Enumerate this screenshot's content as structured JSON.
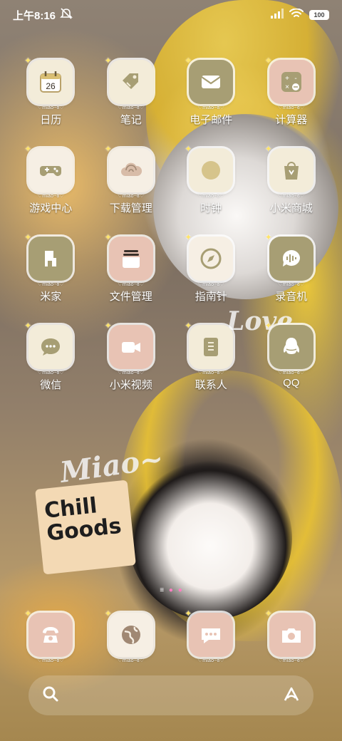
{
  "status_bar": {
    "time": "上午8:16",
    "battery": "100"
  },
  "wallpaper": {
    "word_love": "Love",
    "word_miao": "Miao~",
    "box_text_1": "Chill",
    "box_text_2": "Goods"
  },
  "apps": [
    {
      "label": "日历",
      "tag": "♡miao~ɞ♡",
      "icon": "calendar-icon",
      "date": "26",
      "color": "#f3ecd9"
    },
    {
      "label": "笔记",
      "tag": "♡miao~ɞ♡",
      "icon": "notes-tag-icon",
      "color": "#f3ecd9"
    },
    {
      "label": "电子邮件",
      "tag": "♡miao~ɞ♡",
      "icon": "mail-icon",
      "color": "#a79e74"
    },
    {
      "label": "计算器",
      "tag": "♡miao~ɞ♡",
      "icon": "calculator-icon",
      "color": "#e8c3b4"
    },
    {
      "label": "游戏中心",
      "tag": "♡miao~ɞ♡",
      "icon": "gamepad-icon",
      "color": "#f6efe4"
    },
    {
      "label": "下载管理",
      "tag": "♡miao~ɞ♡",
      "icon": "cloud-download-icon",
      "color": "#f6efe4"
    },
    {
      "label": "时钟",
      "tag": "♡miao~ɞ♡",
      "icon": "clock-icon",
      "color": "#f3ecd9"
    },
    {
      "label": "小米商城",
      "tag": "♡miao~ɞ♡",
      "icon": "shopping-bag-icon",
      "color": "#f3ecd9"
    },
    {
      "label": "米家",
      "tag": "♡miao~ɞ♡",
      "icon": "home-device-icon",
      "color": "#a79e74"
    },
    {
      "label": "文件管理",
      "tag": "♡miao~ɞ♡",
      "icon": "file-manager-icon",
      "color": "#e8c3b4"
    },
    {
      "label": "指南针",
      "tag": "♡miao~ɞ♡",
      "icon": "compass-icon",
      "color": "#f6efe4"
    },
    {
      "label": "录音机",
      "tag": "♡miao~ɞ♡",
      "icon": "voice-recorder-icon",
      "color": "#a79e74"
    },
    {
      "label": "微信",
      "tag": "♡miao~ɞ♡",
      "icon": "chat-bubble-icon",
      "color": "#f3ecd9"
    },
    {
      "label": "小米视频",
      "tag": "♡miao~ɞ♡",
      "icon": "video-camera-icon",
      "color": "#e8c3b4"
    },
    {
      "label": "联系人",
      "tag": "♡miao~ɞ♡",
      "icon": "contacts-book-icon",
      "color": "#f3ecd9"
    },
    {
      "label": "QQ",
      "tag": "♡miao~ɞ♡",
      "icon": "qq-penguin-icon",
      "color": "#a79e74"
    }
  ],
  "dock": [
    {
      "tag": "♡miao~ɞ♡",
      "icon": "phone-icon",
      "color": "#e8c3b4"
    },
    {
      "tag": "♡miao~ɞ♡",
      "icon": "browser-globe-icon",
      "color": "#f6efe4"
    },
    {
      "tag": "♡miao~ɞ♡",
      "icon": "messages-icon",
      "color": "#e8c3b4"
    },
    {
      "tag": "♡miao~ɞ♡",
      "icon": "camera-icon",
      "color": "#e8c3b4"
    }
  ],
  "page_indicator": {
    "pages": 3,
    "active": 2
  },
  "search_bar": {
    "left_icon": "search-icon",
    "right_icon": "assistant-icon"
  }
}
